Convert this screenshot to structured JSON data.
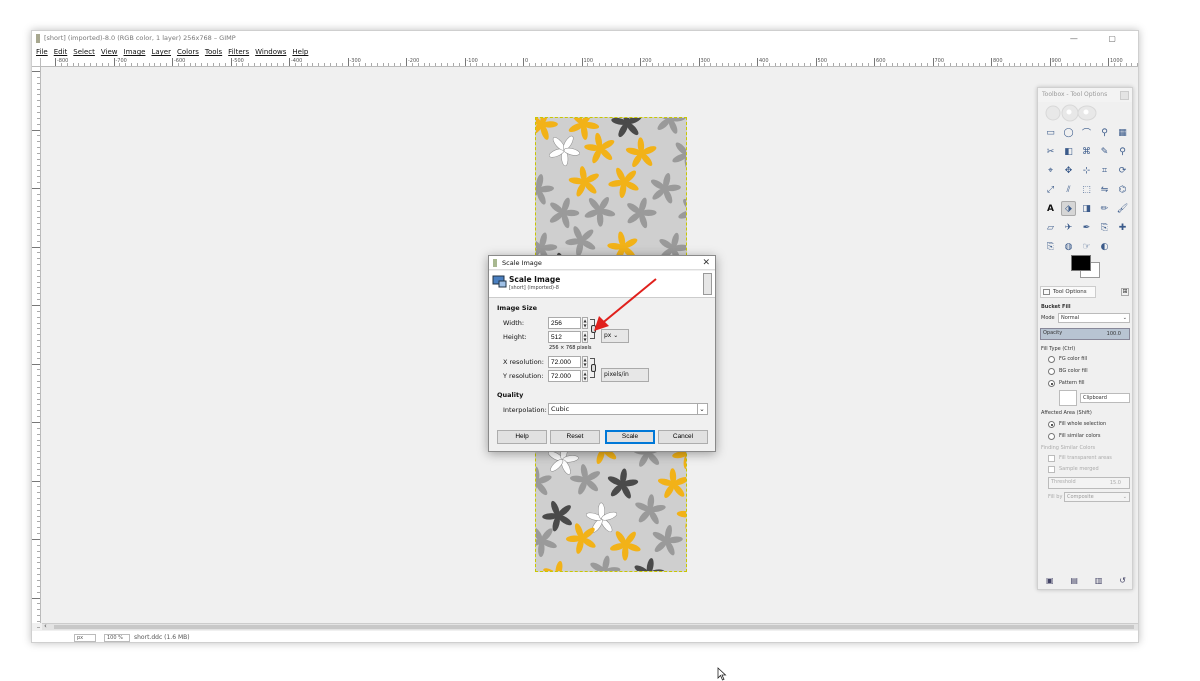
{
  "window": {
    "title": "[short] (imported)-8.0 (RGB color, 1 layer) 256x768 – GIMP",
    "controls": "—  ▢"
  },
  "menubar": {
    "items": [
      "File",
      "Edit",
      "Select",
      "View",
      "Image",
      "Layer",
      "Colors",
      "Tools",
      "Filters",
      "Windows",
      "Help"
    ]
  },
  "ruler": {
    "labels": [
      "-800",
      "-700",
      "-600",
      "-500",
      "-400",
      "-300",
      "-200",
      "-100",
      "0",
      "100",
      "200",
      "300",
      "400",
      "500",
      "600",
      "700",
      "800",
      "900",
      "1000"
    ]
  },
  "statusbar": {
    "unit": "px",
    "zoom": "100 %",
    "info": "short.ddc (1.6 MB)"
  },
  "toolbox": {
    "title": "Toolbox - Tool Options",
    "tab_label": "Tool Options",
    "tool_name": "Bucket Fill",
    "mode_label": "Mode",
    "mode_value": "Normal",
    "opacity_label": "Opacity",
    "opacity_value": "100.0",
    "fill_type_label": "Fill Type  (Ctrl)",
    "fill_types": [
      "FG color fill",
      "BG color fill",
      "Pattern fill"
    ],
    "pattern_name": "Clipboard",
    "affected_area_label": "Affected Area  (Shift)",
    "affected_areas": [
      "Fill whole selection",
      "Fill similar colors"
    ],
    "finding_label": "Finding Similar Colors",
    "fill_transparent": "Fill transparent areas",
    "sample_merged": "Sample merged",
    "threshold_label": "Threshold",
    "threshold_value": "15.0",
    "fill_by_label": "Fill by",
    "fill_by_value": "Composite"
  },
  "dialog": {
    "title": "Scale Image",
    "header_title": "Scale Image",
    "header_subtitle": "[short] (imported)-8",
    "image_size_label": "Image Size",
    "width_label": "Width:",
    "width_value": "256",
    "height_label": "Height:",
    "height_value": "512",
    "size_info": "256 × 768 pixels",
    "size_unit": "px",
    "xres_label": "X resolution:",
    "xres_value": "72.000",
    "yres_label": "Y resolution:",
    "yres_value": "72.000",
    "res_unit": "pixels/in",
    "quality_label": "Quality",
    "interp_label": "Interpolation:",
    "interp_value": "Cubic",
    "buttons": {
      "help": "Help",
      "reset": "Reset",
      "scale": "Scale",
      "cancel": "Cancel"
    }
  },
  "colors": {
    "accent": "#0078d7",
    "arrow": "#e0201c",
    "leaf_yellow": "#f2b218",
    "leaf_dark": "#4a4a4a",
    "leaf_grey": "#9a9a9a",
    "leaf_white": "#ffffff"
  }
}
